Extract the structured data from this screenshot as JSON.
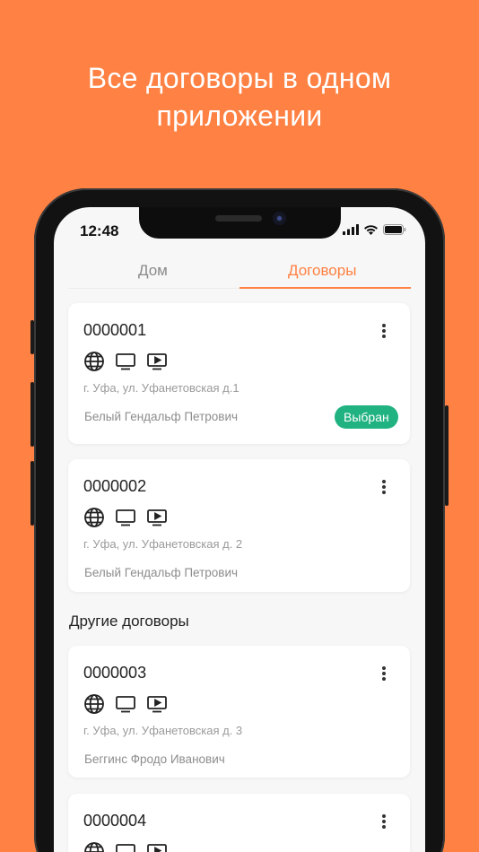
{
  "promo": {
    "line1": "Все договоры в одном",
    "line2": "приложении"
  },
  "status_bar": {
    "time": "12:48"
  },
  "tabs": [
    {
      "label": "Дом",
      "active": false
    },
    {
      "label": "Договоры",
      "active": true
    }
  ],
  "colors": {
    "accent": "#FF8143",
    "badge": "#20B281"
  },
  "contracts": [
    {
      "number": "0000001",
      "address": "г. Уфа, ул. Уфанетовская д.1",
      "owner": "Белый Гендальф Петрович",
      "badge": "Выбран",
      "services": [
        "globe-icon",
        "tv-icon",
        "video-play-icon"
      ]
    },
    {
      "number": "0000002",
      "address": "г. Уфа, ул. Уфанетовская д. 2",
      "owner": "Белый Гендальф Петрович",
      "services": [
        "globe-icon",
        "tv-icon",
        "video-play-icon"
      ]
    }
  ],
  "other_section": {
    "title": "Другие договоры"
  },
  "other_contracts": [
    {
      "number": "0000003",
      "address": "г. Уфа, ул. Уфанетовская д. 3",
      "owner": "Беггинс Фродо Иванович",
      "services": [
        "globe-icon",
        "tv-icon",
        "video-play-icon"
      ]
    },
    {
      "number": "0000004",
      "services": [
        "globe-icon",
        "tv-icon",
        "video-play-icon"
      ]
    }
  ]
}
